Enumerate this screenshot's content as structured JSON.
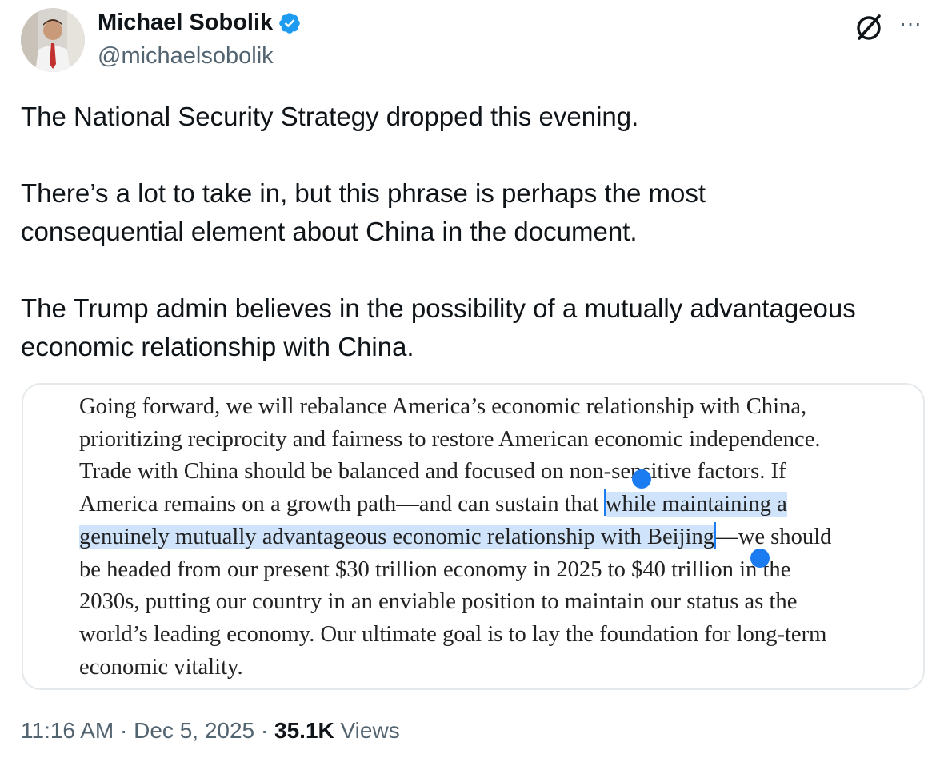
{
  "author": {
    "name": "Michael Sobolik",
    "handle": "@michaelsobolik",
    "verified": true,
    "avatar_icon": "profile-photo-avatar"
  },
  "actions": {
    "grok_icon": "grok-icon",
    "more_icon": "more-dots-icon",
    "more_label": "···"
  },
  "tweet": {
    "paragraphs": [
      "The National Security Strategy dropped this evening.",
      "There’s a lot to take in, but this phrase is perhaps the most consequential element about China in the document.",
      "The Trump admin believes in the possibility of a mutually advantageous economic relationship with China."
    ]
  },
  "quoted_image": {
    "lines": [
      "Going forward, we will rebalance America’s economic relationship with China,",
      "prioritizing reciprocity and fairness to restore American economic independence.",
      "Trade with China should be balanced and focused on non-sensitive factors. If",
      "America remains on a growth path—and can sustain that",
      "while maintaining a",
      "genuinely mutually advantageous economic relationship with Beijing",
      "—we should",
      "be headed from our present $30 trillion economy in 2025 to $40 trillion in the",
      "2030s, putting our country in an enviable position to maintain our status as the",
      "world’s leading economy. Our ultimate goal is to lay the foundation for long-term",
      "economic vitality."
    ],
    "highlight_color": "#cfe4fb",
    "selection_handle_color": "#1a7cf0"
  },
  "meta": {
    "time": "11:16 AM",
    "separator": "·",
    "date": "Dec 5, 2025",
    "views_count": "35.1K",
    "views_label": "Views"
  },
  "colors": {
    "text_primary": "#0f1419",
    "text_secondary": "#536471",
    "verified_badge": "#1d9bf0",
    "card_border": "#e5e9ec"
  }
}
